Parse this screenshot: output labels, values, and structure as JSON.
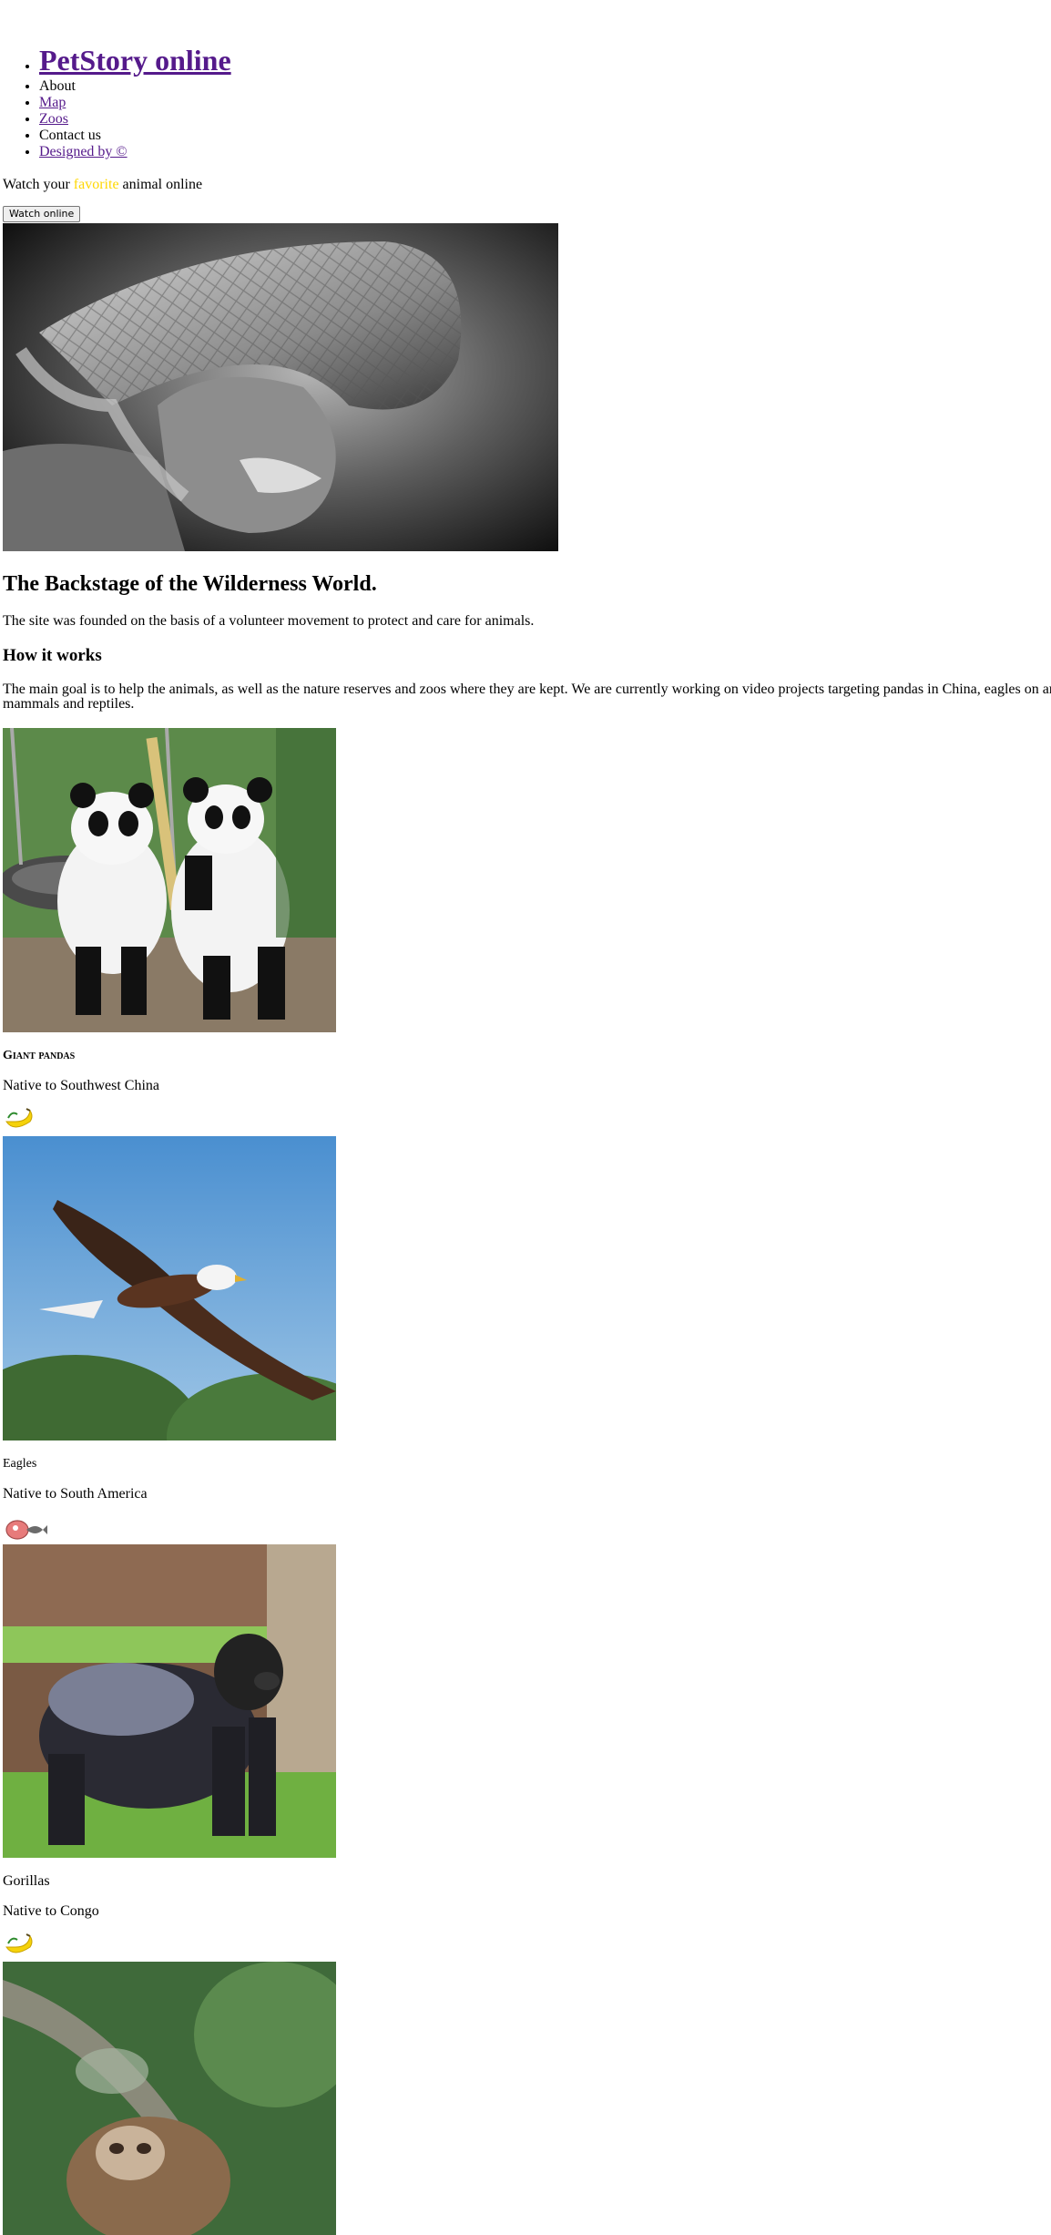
{
  "brand": {
    "title": "PetStory online"
  },
  "nav": {
    "items": [
      "About",
      "Map",
      "Zoos",
      "Contact us",
      "Designed by ©"
    ]
  },
  "hero": {
    "text_before": "Watch your ",
    "text_highlight": "favorite",
    "text_after": " animal online",
    "button_label": "Watch online",
    "highlight_color": "#ffd700"
  },
  "about": {
    "heading": "The Backstage of the Wilderness World.",
    "founded": "The site was founded on the basis of a volunteer movement to protect and care for animals.",
    "how_heading": "How it works",
    "goal": "The main goal is to help the animals, as well as the nature reserves and zoos where they are kept. We are currently working on video projects targeting pandas in China, eagles on an mammals and reptiles."
  },
  "animals": [
    {
      "name": "Giant pandas",
      "native": "Native to Southwest China",
      "food_icon": "banana-icon"
    },
    {
      "name": "Eagles",
      "native": "Native to South America",
      "food_icon": "meat-fish-icon"
    },
    {
      "name": "Gorillas",
      "native": "Native to Congo",
      "food_icon": "banana-icon"
    }
  ],
  "colors": {
    "link": "#551a8b",
    "text": "#000000",
    "background": "#ffffff"
  }
}
